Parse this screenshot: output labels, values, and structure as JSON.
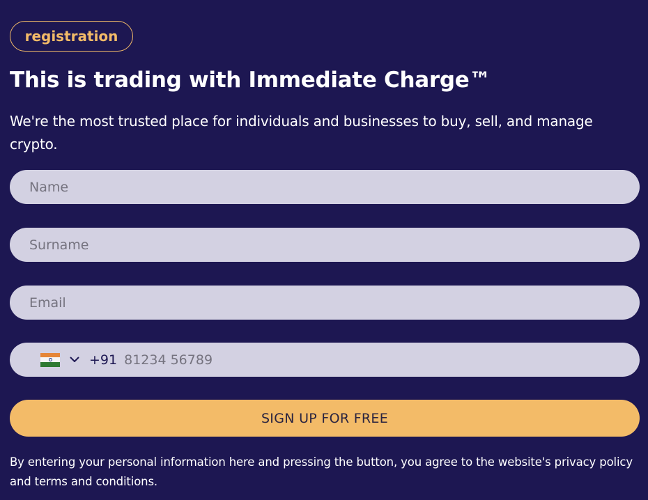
{
  "badge": {
    "label": "registration"
  },
  "heading": {
    "title": "This is trading with Immediate Charge™",
    "subtitle": "We're the most trusted place for individuals and businesses to buy, sell, and manage crypto."
  },
  "form": {
    "name": {
      "placeholder": "Name",
      "value": ""
    },
    "surname": {
      "placeholder": "Surname",
      "value": ""
    },
    "email": {
      "placeholder": "Email",
      "value": ""
    },
    "phone": {
      "country_flag_icon": "india-flag-icon",
      "dial_code": "+91",
      "placeholder": "81234 56789",
      "value": ""
    },
    "submit_label": "SIGN UP FOR FREE",
    "disclaimer": "By entering your personal information here and pressing the button, you agree to the website's privacy policy and terms and conditions."
  },
  "colors": {
    "background": "#1d1752",
    "accent": "#f3bb68",
    "field_bg": "#d3d1e2",
    "text": "#ffffff"
  }
}
